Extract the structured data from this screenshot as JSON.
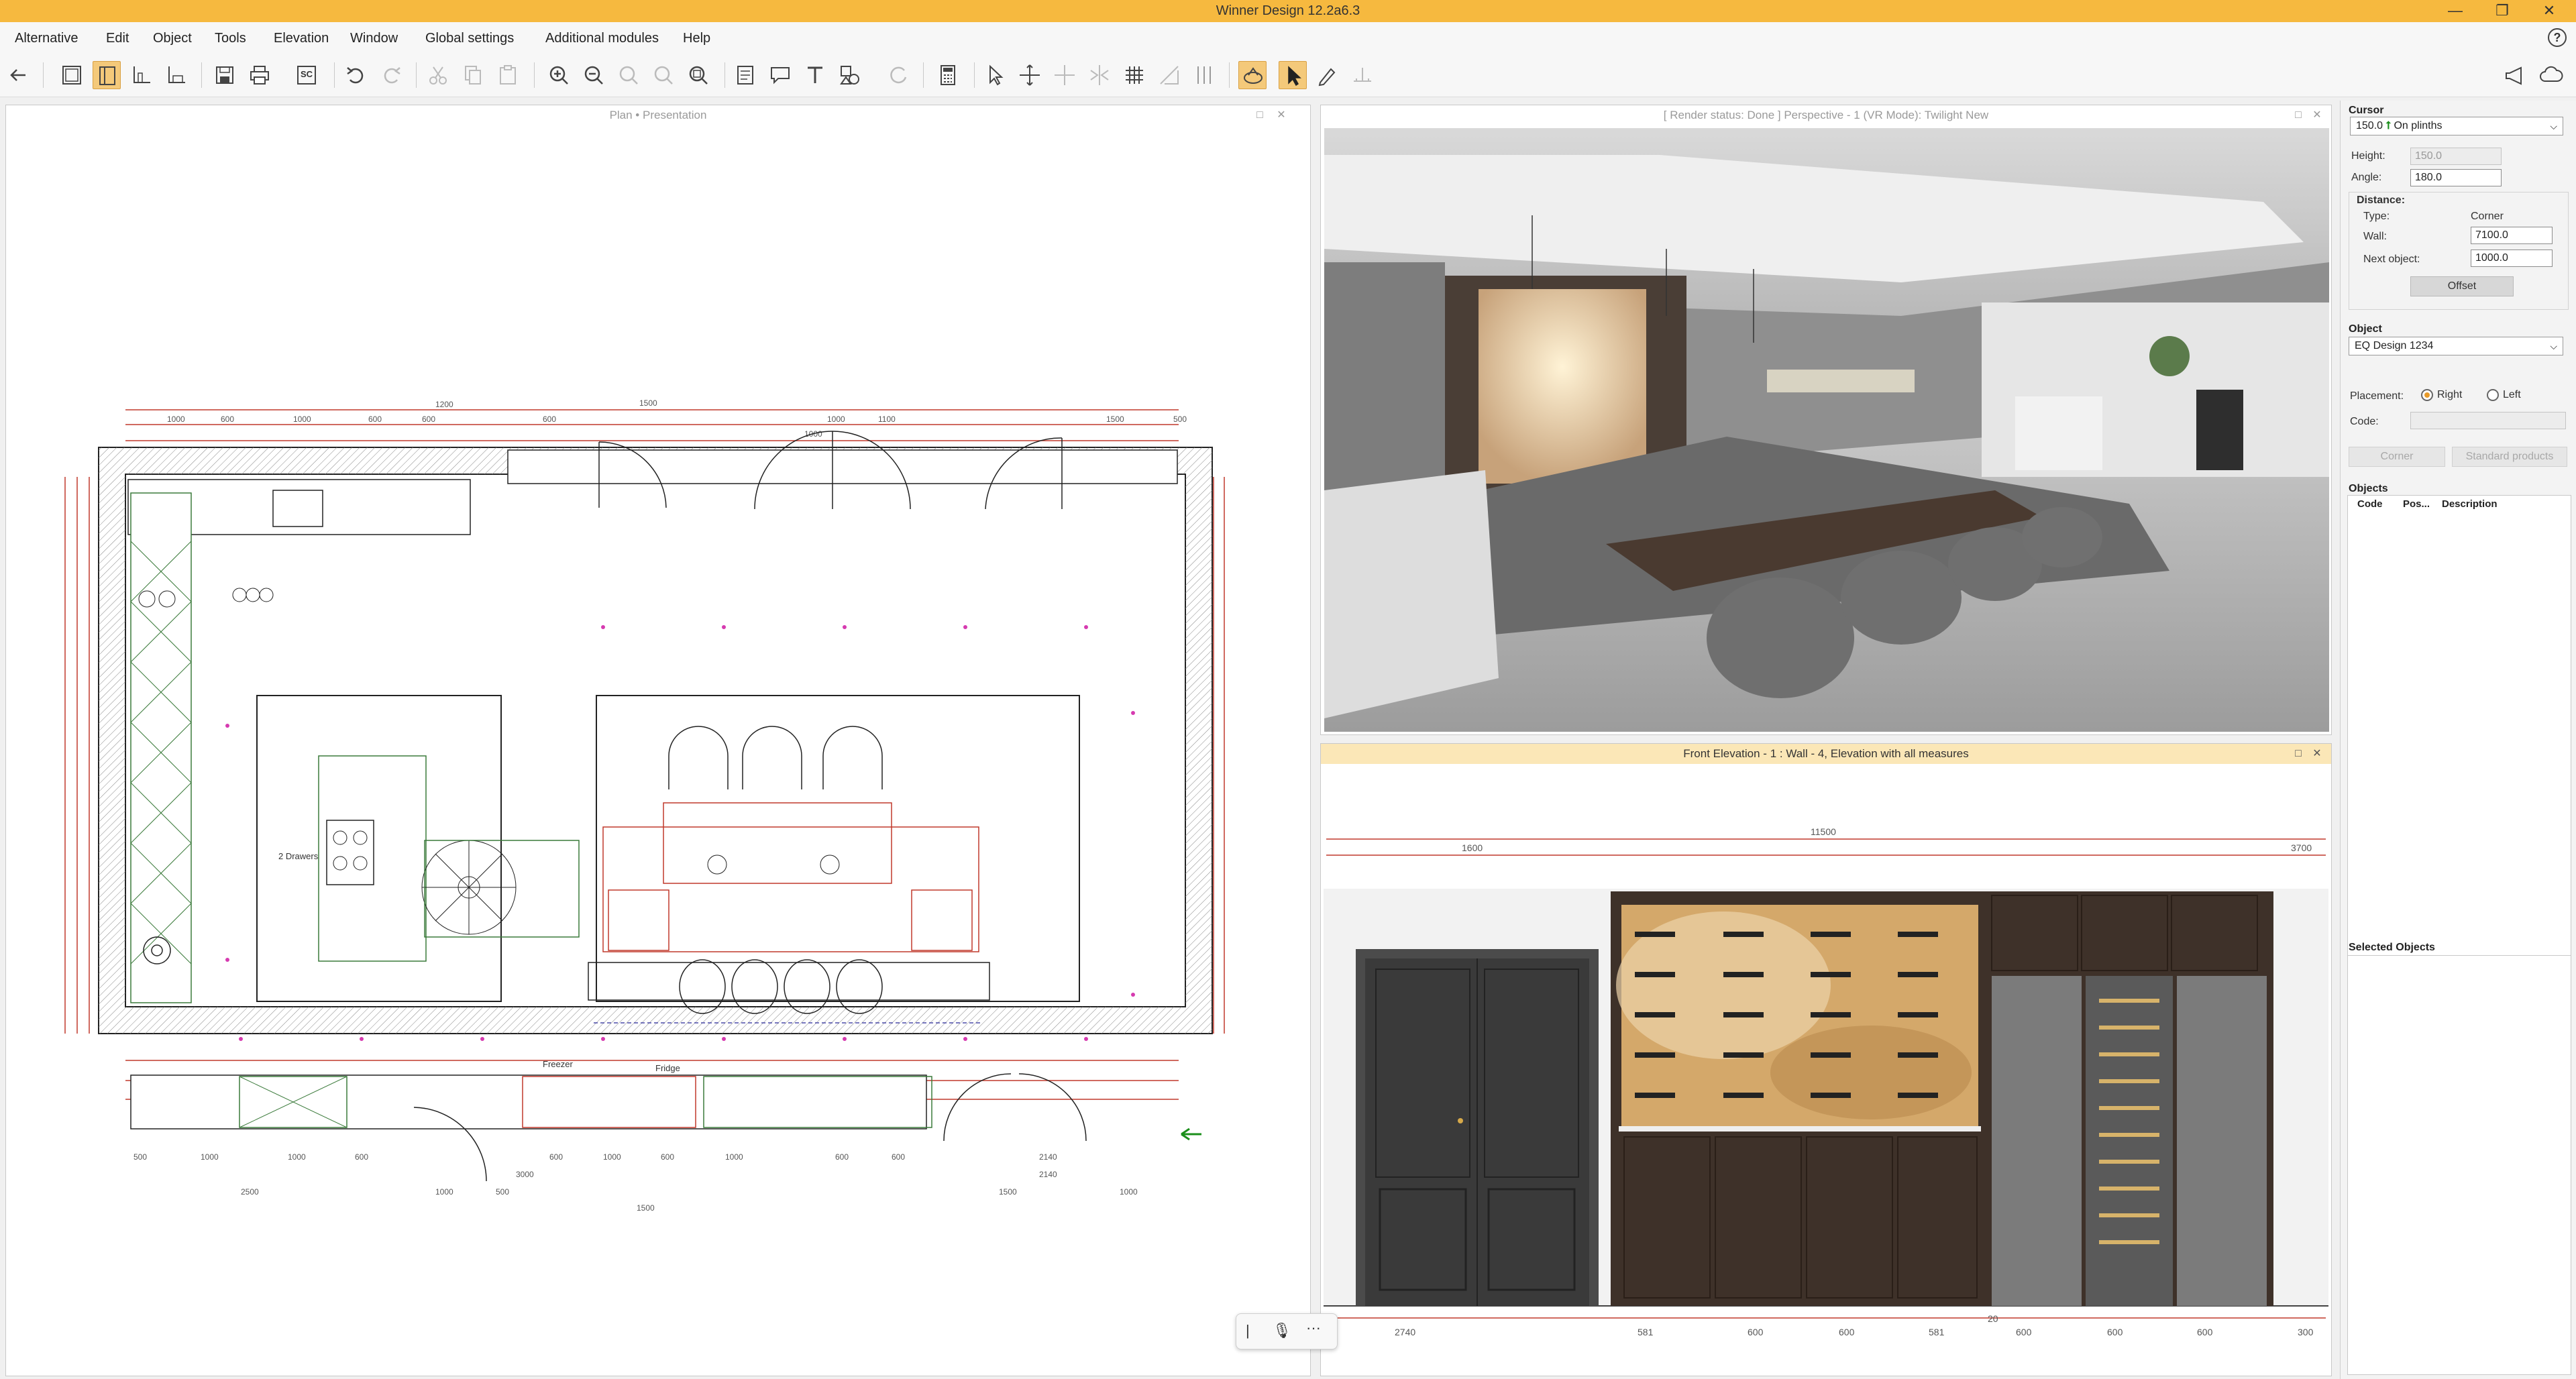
{
  "window": {
    "title": "Winner Design 12.2a6.3",
    "controls": {
      "minimize": "—",
      "restore": "❐",
      "close": "✕"
    }
  },
  "menu": {
    "items": [
      "Alternative",
      "Edit",
      "Object",
      "Tools",
      "Elevation",
      "Window",
      "Global settings",
      "Additional modules",
      "Help"
    ],
    "help_icon": "?"
  },
  "toolbar": {
    "calc_label": "SC"
  },
  "plan_panel": {
    "title": "Plan • Presentation",
    "labels": {
      "drawers": "2 Drawers",
      "freezer": "Freezer",
      "fridge": "Fridge"
    },
    "dims_top": [
      "1000",
      "600",
      "1000",
      "600",
      "600",
      "1000",
      "600",
      "1000",
      "1500",
      "1200",
      "1500",
      "500",
      "1100"
    ],
    "dims_bottom": [
      "500",
      "1000",
      "1000",
      "600",
      "600",
      "1000",
      "600",
      "1000",
      "600",
      "600",
      "2140",
      "2140",
      "2500",
      "1500",
      "1000",
      "500",
      "1500",
      "1000",
      "3000"
    ]
  },
  "render_panel": {
    "title": "[ Render status: Done ] Perspective - 1 (VR Mode): Twilight New"
  },
  "elevation_panel": {
    "title": "Front Elevation - 1 : Wall - 4, Elevation with all measures",
    "dims_top": [
      "11500",
      "1600",
      "3700"
    ],
    "dims_bottom": [
      "2740",
      "581",
      "600",
      "600",
      "581",
      "600",
      "600",
      "600",
      "300"
    ],
    "dim_small": "20"
  },
  "properties": {
    "cursor": {
      "heading": "Cursor",
      "mode_value": "150.0",
      "mode_text": "On plinths",
      "height_label": "Height:",
      "height_value": "150.0",
      "angle_label": "Angle:",
      "angle_value": "180.0",
      "distance_heading": "Distance:",
      "type_label": "Type:",
      "type_value": "Corner",
      "wall_label": "Wall:",
      "wall_value": "7100.0",
      "next_label": "Next object:",
      "next_value": "1000.0",
      "offset_button": "Offset"
    },
    "object": {
      "heading": "Object",
      "selected": "EQ Design 1234",
      "placement_label": "Placement:",
      "right_label": "Right",
      "left_label": "Left",
      "code_label": "Code:",
      "corner_button": "Corner",
      "standard_button": "Standard products"
    },
    "objects": {
      "heading": "Objects",
      "columns": [
        "Code",
        "Pos...",
        "Description"
      ]
    },
    "selected_objects": {
      "heading": "Selected Objects"
    }
  },
  "mic_bar": {
    "pipe": "|",
    "more": "···"
  }
}
